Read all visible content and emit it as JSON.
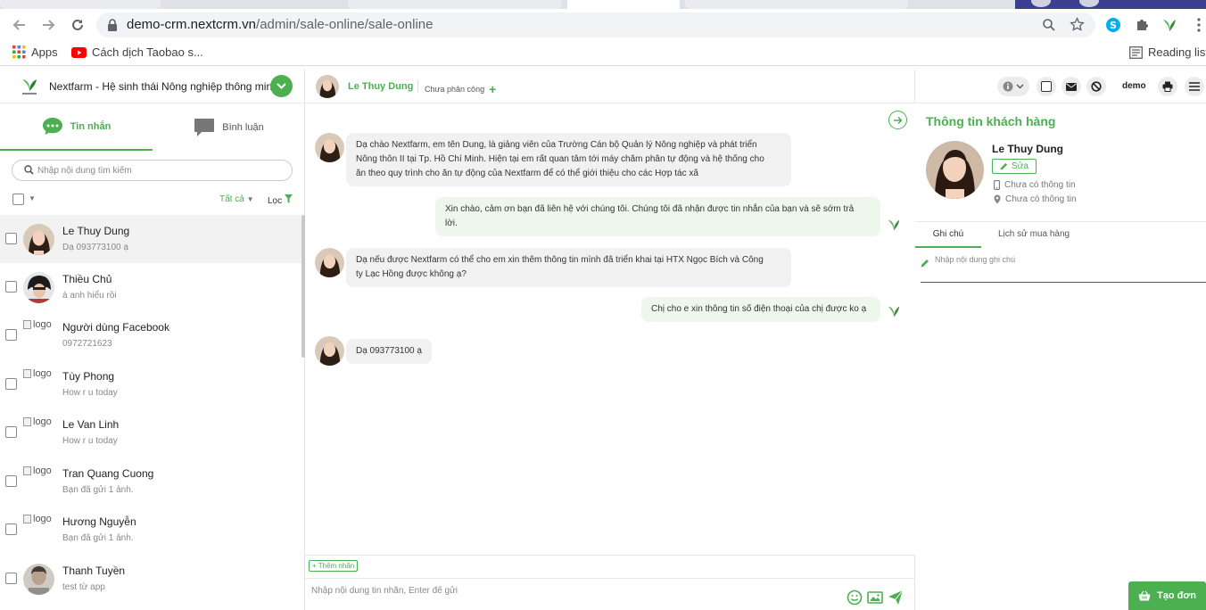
{
  "browser": {
    "url_host": "demo-crm.nextcrm.vn",
    "url_path": "/admin/sale-online/sale-online",
    "bookmarks": [
      {
        "label": "Apps",
        "icon": "apps-grid-icon"
      },
      {
        "label": "Cách dịch Taobao s...",
        "icon": "youtube-icon"
      }
    ],
    "reading_list_label": "Reading list"
  },
  "brand": {
    "name": "Nextfarm - Hệ sinh thái Nông nghiệp thông minh"
  },
  "left_tabs": {
    "messages_label": "Tin nhắn",
    "comments_label": "Bình luận"
  },
  "search": {
    "placeholder": "Nhập nội dung tìm kiếm"
  },
  "filters": {
    "all_label": "Tất cả",
    "filter_label": "Lọc"
  },
  "broken_image_alt": "logo",
  "conversations": [
    {
      "name": "Le Thuy Dung",
      "preview": "Dạ 093773100 ạ",
      "selected": true,
      "avatar": "photo"
    },
    {
      "name": "Thiều Chủ",
      "preview": "à anh hiểu rồi",
      "selected": false,
      "avatar": "photo"
    },
    {
      "name": "Người dùng Facebook",
      "preview": "0972721623",
      "selected": false,
      "avatar": "broken"
    },
    {
      "name": "Tùy Phong",
      "preview": "How r u today",
      "selected": false,
      "avatar": "broken"
    },
    {
      "name": "Le Van Linh",
      "preview": "How r u today",
      "selected": false,
      "avatar": "broken"
    },
    {
      "name": "Tran Quang Cuong",
      "preview": "Bạn đã gửi 1 ảnh.",
      "selected": false,
      "avatar": "broken"
    },
    {
      "name": "Hương Nguyễn",
      "preview": "Bạn đã gửi 1 ảnh.",
      "selected": false,
      "avatar": "broken"
    },
    {
      "name": "Thanh Tuyền",
      "preview": "test từ app",
      "selected": false,
      "avatar": "photo"
    }
  ],
  "chat": {
    "contact_name": "Le Thuy Dung",
    "assign_label": "Chưa phân công",
    "messages": [
      {
        "direction": "in",
        "lines": [
          "Dạ chào Nextfarm, em tên Dung, là giảng viên của Trường Cán bộ Quản lý Nông nghiệp và phát triển",
          "Nông thôn II tại Tp. Hồ Chí Minh. Hiện tại em rất quan tâm tới máy chăm phân tự động và hệ thống cho",
          "ăn theo quy trình cho ăn tự động của Nextfarm để có thể giới thiệu cho các Hợp tác xã"
        ]
      },
      {
        "direction": "out",
        "lines": [
          "Xin chào, cảm ơn bạn đã liên hệ với chúng tôi. Chúng tôi đã nhận được tin nhắn của bạn và sẽ sớm trả",
          "lời."
        ]
      },
      {
        "direction": "in",
        "lines": [
          "Dạ nếu được Nextfarm có thể cho em xin thêm thông tin mình đã triển khai tại HTX Ngọc Bích và Công",
          "ty Lạc Hồng được không ạ?"
        ]
      },
      {
        "direction": "out",
        "lines": [
          "Chị cho e xin thông tin số điện thoại của chị được ko ạ"
        ]
      },
      {
        "direction": "in",
        "lines": [
          "Dạ 093773100 ạ"
        ]
      }
    ],
    "add_tag_label": "+ Thêm nhãn",
    "composer_placeholder": "Nhập nội dung tin nhắn, Enter để gửi"
  },
  "right": {
    "user_label": "demo",
    "title": "Thông tin khách hàng",
    "customer_name": "Le Thuy Dung",
    "edit_label": "Sửa",
    "phone": "Chưa có thông tin",
    "address": "Chưa có thông tin",
    "tab_notes": "Ghi chú",
    "tab_history": "Lịch sử mua hàng",
    "note_placeholder": "Nhập nội dung ghi chú",
    "create_order_label": "Tạo đơn"
  },
  "colors": {
    "accent": "#4caf50",
    "incoming_bubble": "#f1f1f1",
    "outgoing_bubble": "#eef7ec"
  }
}
